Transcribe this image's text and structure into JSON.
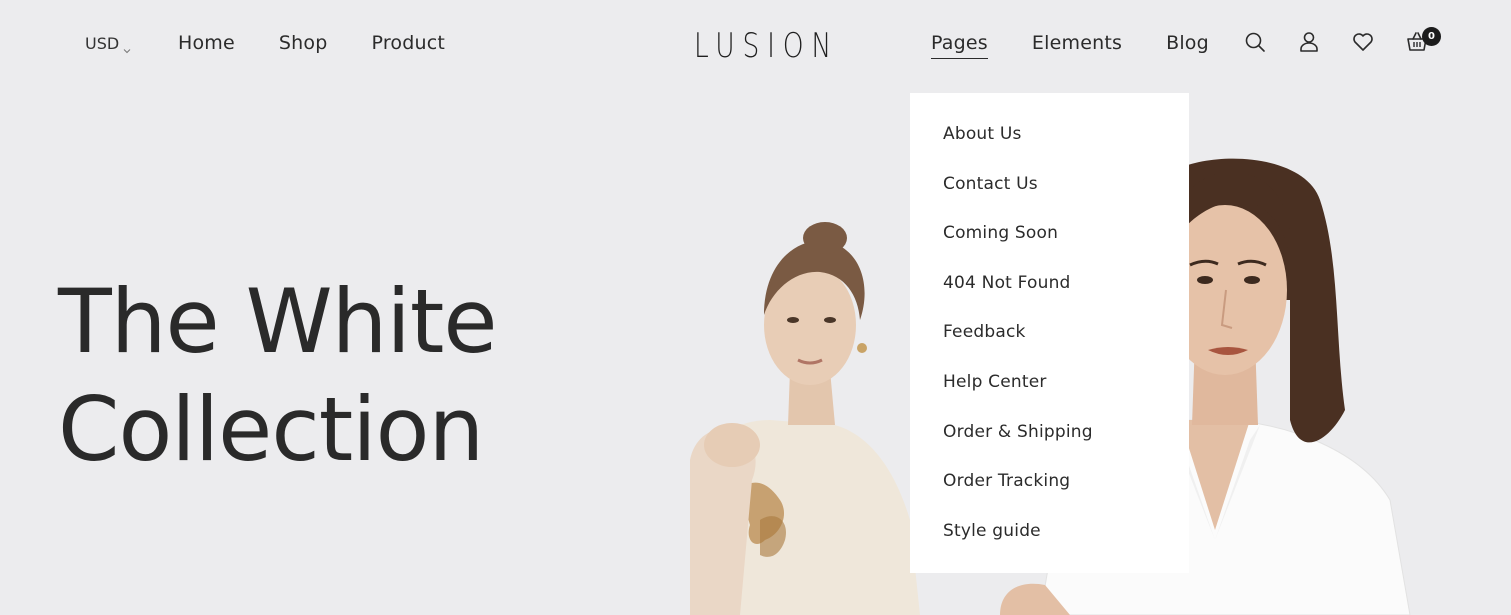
{
  "header": {
    "currency": "USD",
    "nav_left": [
      "Home",
      "Shop",
      "Product"
    ],
    "logo": "LUSION",
    "nav_right": [
      "Pages",
      "Elements",
      "Blog"
    ],
    "active_nav": "Pages",
    "icons": [
      "search-icon",
      "user-icon",
      "heart-icon",
      "cart-icon"
    ],
    "cart_count": "0"
  },
  "dropdown": {
    "items": [
      "About Us",
      "Contact Us",
      "Coming Soon",
      "404 Not Found",
      "Feedback",
      "Help Center",
      "Order & Shipping",
      "Order Tracking",
      "Style guide"
    ]
  },
  "hero": {
    "title_line1": "The White",
    "title_line2": "Collection"
  },
  "colors": {
    "background": "#ececee",
    "text": "#2b2b2b",
    "dropdown_bg": "#ffffff",
    "badge": "#1c1c1c"
  }
}
